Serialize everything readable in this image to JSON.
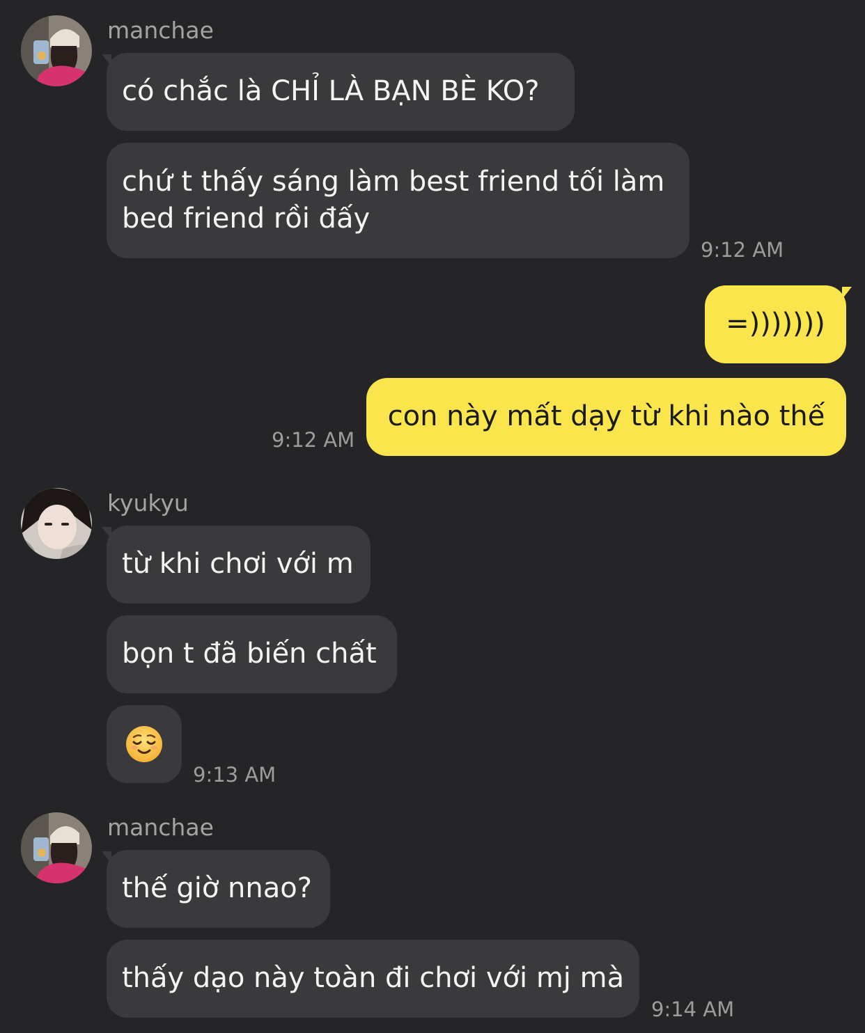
{
  "colors": {
    "background": "#252527",
    "incoming_bubble": "#3a3a3c",
    "outgoing_bubble": "#fae54d",
    "timestamp": "#9c9c9c",
    "sender_name": "#a3a3a3"
  },
  "groups": [
    {
      "sender": "manchae",
      "avatar_icon": "profile-photo-manchae",
      "messages": [
        "có chắc là CHỈ LÀ BẠN BÈ KO?",
        "chứ t thấy sáng làm best friend tối làm bed friend rồi đấy"
      ],
      "time": "9:12 AM"
    },
    {
      "sender": "me",
      "messages": [
        "=)))))))",
        "con này mất dạy từ khi nào thế"
      ],
      "time": "9:12 AM"
    },
    {
      "sender": "kyukyu",
      "avatar_icon": "profile-photo-kyukyu",
      "messages": [
        "từ khi chơi với m",
        "bọn t đã biến chất",
        "😌"
      ],
      "time": "9:13 AM"
    },
    {
      "sender": "manchae",
      "avatar_icon": "profile-photo-manchae",
      "messages": [
        "thế giờ nnao?",
        "thấy dạo này toàn đi chơi với mj mà"
      ],
      "time": "9:14 AM"
    }
  ]
}
